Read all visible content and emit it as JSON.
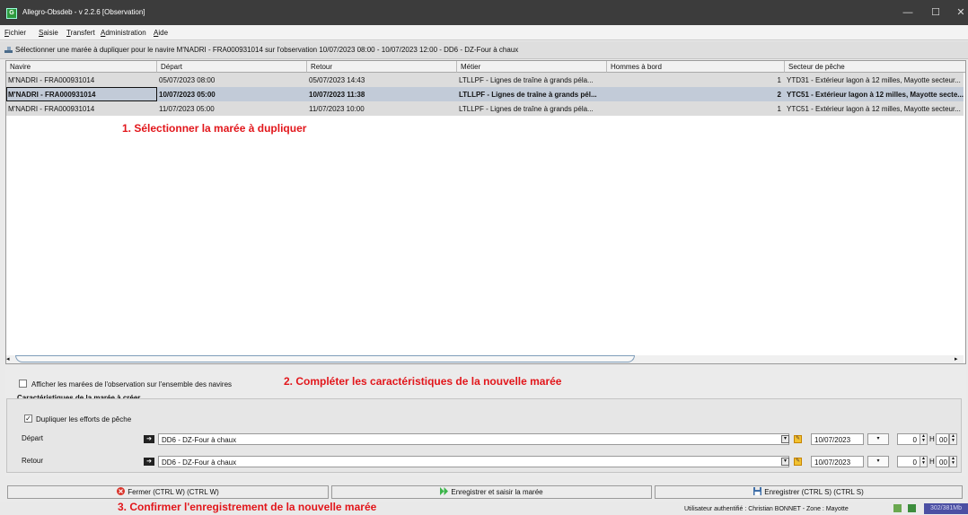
{
  "window": {
    "title": "Allegro-Obsdeb - v 2.2.6 [Observation]",
    "app_icon_letter": "G",
    "minimize_glyph": "—",
    "maximize_glyph": "☐",
    "close_glyph": "✕"
  },
  "menu": [
    "Fichier",
    "Saisie",
    "Transfert",
    "Administration",
    "Aide"
  ],
  "infobar": {
    "text": "Sélectionner une marée à dupliquer pour le navire M'NADRI - FRA000931014 sur l'observation 10/07/2023 08:00 - 10/07/2023 12:00 - DD6 - DZ-Four à chaux"
  },
  "table": {
    "columns": [
      "Navire",
      "Départ",
      "Retour",
      "Métier",
      "Hommes à bord",
      "Secteur de pêche"
    ],
    "rows": [
      [
        "M'NADRI - FRA000931014",
        "05/07/2023 08:00",
        "05/07/2023 14:43",
        "LTLLPF - Lignes de traîne à grands péla...",
        "1",
        "YTD31 - Extérieur lagon à 12 milles, Mayotte secteur..."
      ],
      [
        "M'NADRI - FRA000931014",
        "10/07/2023 05:00",
        "10/07/2023 11:38",
        "LTLLPF - Lignes de traîne à grands pél...",
        "2",
        "YTC51 - Extérieur lagon à 12 milles, Mayotte secte..."
      ],
      [
        "M'NADRI - FRA000931014",
        "11/07/2023 05:00",
        "11/07/2023 10:00",
        "LTLLPF - Lignes de traîne à grands péla...",
        "1",
        "YTC51 - Extérieur lagon à 12 milles, Mayotte secteur..."
      ]
    ],
    "selected_row": 1
  },
  "annotations": {
    "step1": "1. Sélectionner la marée à dupliquer",
    "step2": "2. Compléter les caractéristiques de la nouvelle marée",
    "step3": "3. Confirmer l'enregistrement de la nouvelle marée"
  },
  "options": {
    "show_all_vessels_label": "Afficher les marées de l'observation sur l'ensemble des navires",
    "show_all_vessels_checked": false,
    "section_title": "Caractéristiques de la marée à créer",
    "duplicate_efforts_label": "Dupliquer les efforts de pêche",
    "duplicate_efforts_checked": true
  },
  "depart": {
    "label": "Départ",
    "location": "DD6 - DZ-Four à chaux",
    "date": "10/07/2023",
    "hour": "0",
    "hour_sep": "H",
    "minute": "00"
  },
  "retour": {
    "label": "Retour",
    "location": "DD6 - DZ-Four à chaux",
    "date": "10/07/2023",
    "hour": "0",
    "hour_sep": "H",
    "minute": "00"
  },
  "buttons": {
    "close": "Fermer (CTRL W) (CTRL W)",
    "save_and_enter": "Enregistrer et saisir la marée",
    "save": "Enregistrer (CTRL S) (CTRL S)"
  },
  "status": {
    "user": "Utilisateur authentifié : Christian BONNET - Zone : Mayotte",
    "memory": "302/381Mb"
  },
  "colors": {
    "annotation": "#e2161b",
    "titlebar": "#3c3c3c",
    "selected_row": "#c2cbd8",
    "save_and_enter_icon": "#3bb54a",
    "close_icon": "#d9342b"
  }
}
